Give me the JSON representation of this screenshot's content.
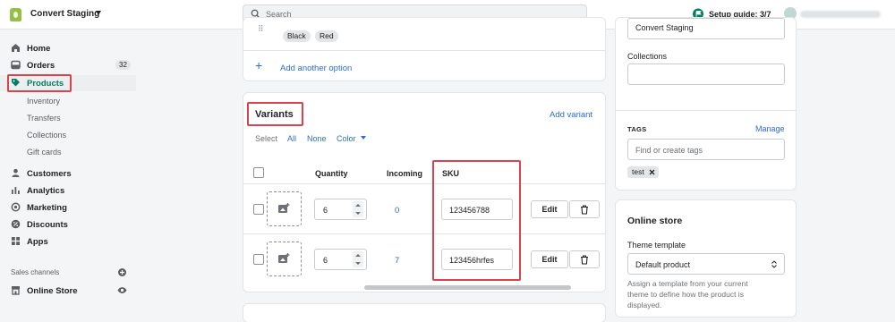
{
  "topbar": {
    "store_name": "Convert Staging",
    "search_placeholder": "Search",
    "setup_guide": "Setup guide: 3/7"
  },
  "sidebar": {
    "home": "Home",
    "orders": "Orders",
    "orders_count": "32",
    "products": "Products",
    "inventory": "Inventory",
    "transfers": "Transfers",
    "collections": "Collections",
    "gift_cards": "Gift cards",
    "customers": "Customers",
    "analytics": "Analytics",
    "marketing": "Marketing",
    "discounts": "Discounts",
    "apps": "Apps",
    "sales_channels": "Sales channels",
    "online_store": "Online Store"
  },
  "options": {
    "values": [
      "Black",
      "Red"
    ],
    "add_option": "Add another option"
  },
  "variants": {
    "title": "Variants",
    "add_variant": "Add variant",
    "select_label": "Select",
    "select_all": "All",
    "select_none": "None",
    "select_color": "Color",
    "columns": {
      "quantity": "Quantity",
      "incoming": "Incoming",
      "sku": "SKU"
    },
    "rows": [
      {
        "quantity": "6",
        "incoming": "0",
        "sku": "123456788",
        "edit": "Edit"
      },
      {
        "quantity": "6",
        "incoming": "7",
        "sku": "123456hrfes",
        "edit": "Edit"
      }
    ]
  },
  "organization": {
    "vendor_value": "Convert Staging",
    "collections_label": "Collections",
    "tags_label": "TAGS",
    "manage": "Manage",
    "tags_placeholder": "Find or create tags",
    "tag": "test"
  },
  "online_store": {
    "title": "Online store",
    "theme_template_label": "Theme template",
    "theme_template_value": "Default product",
    "help_text_1": "Assign a template from your current",
    "help_text_2": "theme to define how the product is",
    "help_text_3": "displayed."
  },
  "colors": {
    "highlight": "#d9434c",
    "active": "#008060",
    "link": "#2c6ecb"
  }
}
